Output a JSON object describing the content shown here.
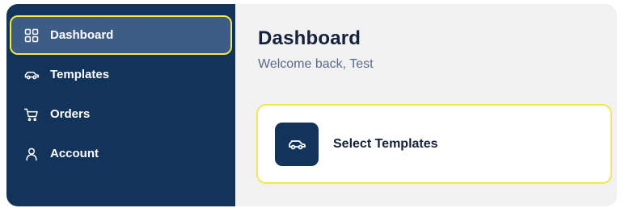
{
  "sidebar": {
    "items": [
      {
        "label": "Dashboard",
        "icon": "grid-icon",
        "active": true
      },
      {
        "label": "Templates",
        "icon": "car-icon",
        "active": false
      },
      {
        "label": "Orders",
        "icon": "cart-icon",
        "active": false
      },
      {
        "label": "Account",
        "icon": "user-icon",
        "active": false
      }
    ]
  },
  "main": {
    "title": "Dashboard",
    "subtitle": "Welcome back, Test",
    "card": {
      "label": "Select Templates",
      "icon": "car-icon"
    }
  },
  "colors": {
    "sidebar_bg": "#12345b",
    "active_item_bg": "#3d5d87",
    "highlight_outline": "#f2e84b",
    "main_bg": "#f1f1f2"
  }
}
